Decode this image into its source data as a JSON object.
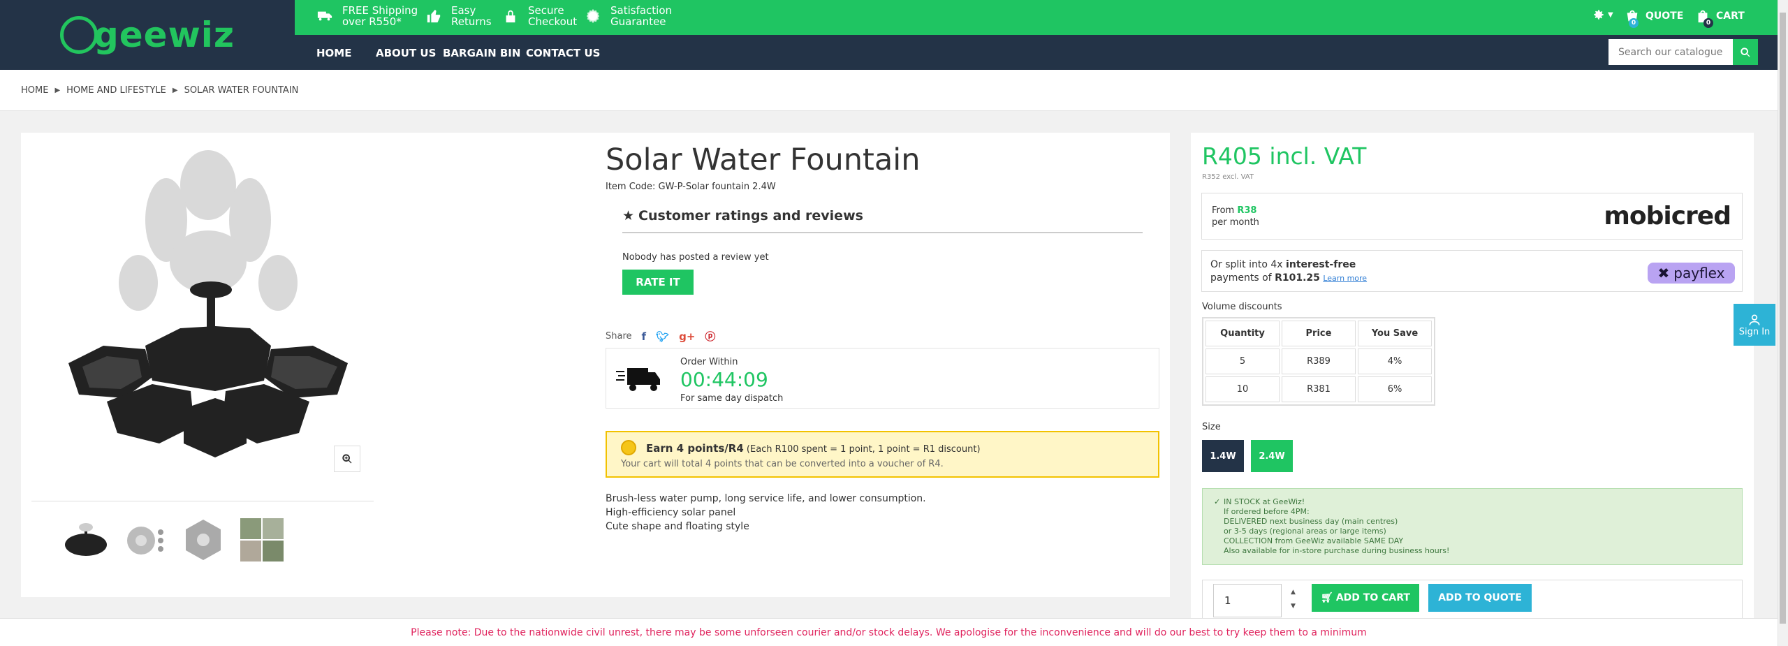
{
  "header": {
    "logo_text": "geewiz",
    "usps": [
      {
        "line1": "FREE Shipping",
        "line2": "over R550*",
        "icon": "truck-icon"
      },
      {
        "line1": "Easy",
        "line2": "Returns",
        "icon": "thumbs-up-icon"
      },
      {
        "line1": "Secure",
        "line2": "Checkout",
        "icon": "lock-icon"
      },
      {
        "line1": "Satisfaction",
        "line2": "Guarantee",
        "icon": "badge-icon"
      }
    ],
    "quote_label": "QUOTE",
    "quote_count": "0",
    "cart_label": "CART",
    "cart_count": "0",
    "nav": [
      "HOME",
      "ABOUT US",
      "BARGAIN BIN",
      "CONTACT US"
    ],
    "search_placeholder": "Search our catalogue"
  },
  "breadcrumb": [
    "HOME",
    "HOME AND LIFESTYLE",
    "SOLAR WATER FOUNTAIN"
  ],
  "product": {
    "title": "Solar Water Fountain",
    "item_code_label": "Item Code:",
    "item_code": "GW-P-Solar fountain 2.4W",
    "reviews_heading": "Customer ratings and reviews",
    "no_reviews": "Nobody has posted a review yet",
    "rate_button": "RATE IT",
    "share_label": "Share",
    "order_within": "Order Within",
    "countdown": "00:44:09",
    "dispatch_note": "For same day dispatch",
    "points_bold": "Earn 4 points/R4",
    "points_detail": "(Each R100 spent = 1 point, 1 point = R1 discount)",
    "points_line2": "Your cart will total 4 points that can be converted into a voucher of R4.",
    "features": [
      "Brush-less water pump, long service life, and lower consumption.",
      "High-efficiency solar panel",
      "Cute shape and floating style"
    ]
  },
  "pricing": {
    "price_incl": "R405 incl. VAT",
    "price_excl": "R352 excl. VAT",
    "mobicred_from": "From",
    "mobicred_amount": "R38",
    "mobicred_period": "per month",
    "mobicred_brand": "mobicred",
    "payflex_pre": "Or split into 4x",
    "payflex_bold": "interest-free",
    "payflex_line2_pre": "payments of",
    "payflex_amount": "R101.25",
    "payflex_learn": "Learn more",
    "payflex_brand": "payflex",
    "volume_label": "Volume discounts",
    "volume_headers": [
      "Quantity",
      "Price",
      "You Save"
    ],
    "volume_rows": [
      [
        "5",
        "R389",
        "4%"
      ],
      [
        "10",
        "R381",
        "6%"
      ]
    ],
    "size_label": "Size",
    "sizes": [
      "1.4W",
      "2.4W"
    ],
    "stock_lines": [
      "IN STOCK at GeeWiz!",
      "If ordered before 4PM:",
      "DELIVERED next business day (main centres)",
      "or 3-5 days (regional areas or large items)",
      "COLLECTION from GeeWiz available SAME DAY",
      "Also available for in-store purchase during business hours!"
    ],
    "quantity": "1",
    "add_to_cart": "ADD TO CART",
    "add_to_quote": "ADD TO QUOTE"
  },
  "signin_label": "Sign In",
  "notice": "Please note: Due to the nationwide civil unrest, there may be some unforseen courier and/or stock delays. We apologise for the inconvenience and will do our best to try keep them to a minimum",
  "colors": {
    "brand_green": "#1fc562",
    "header_navy": "#233347",
    "accent_blue": "#2db3d6",
    "notice_red": "#e0245e"
  }
}
